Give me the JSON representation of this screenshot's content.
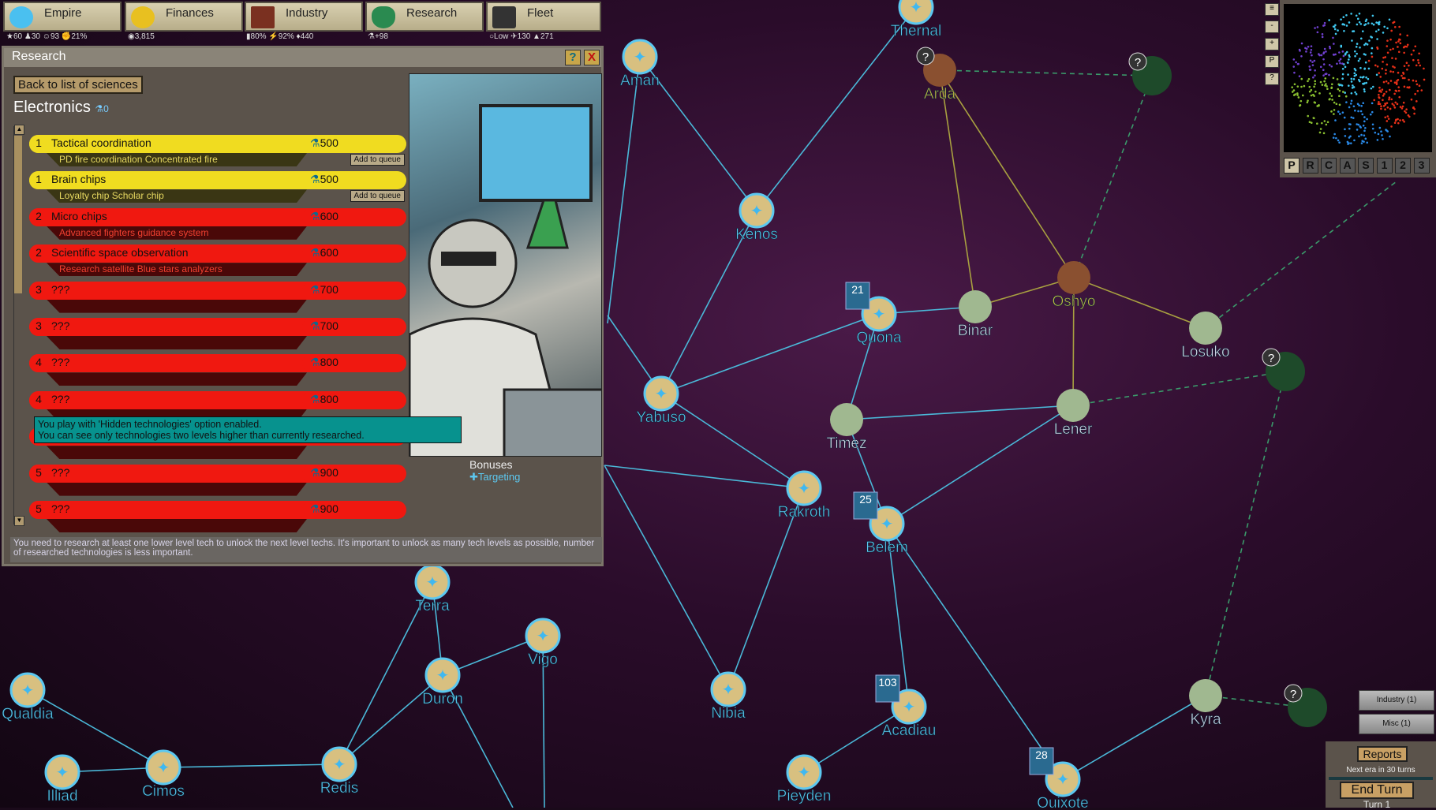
{
  "topbar": {
    "tabs": [
      {
        "label": "Empire",
        "icon": "eagle-icon"
      },
      {
        "label": "Finances",
        "icon": "coin-icon"
      },
      {
        "label": "Industry",
        "icon": "factory-icon"
      },
      {
        "label": "Research",
        "icon": "flask-icon"
      },
      {
        "label": "Fleet",
        "icon": "ship-icon"
      }
    ],
    "stats": {
      "empire": [
        "60",
        "30",
        "93",
        "21%"
      ],
      "finances": [
        "3,815"
      ],
      "industry": [
        "80%",
        "92%",
        "440"
      ],
      "research": [
        "+98"
      ],
      "fleet": [
        "Low",
        "130",
        "271"
      ]
    }
  },
  "panel": {
    "title": "Research",
    "help": "?",
    "close": "X",
    "back_label": "Back to list of sciences",
    "category": "Electronics",
    "category_points": "0",
    "queue_label": "Add to queue",
    "techs": [
      {
        "level": "1",
        "name": "Tactical coordination",
        "cost": "500",
        "unlocks": "PD fire coordination   Concentrated fire",
        "status": "available"
      },
      {
        "level": "1",
        "name": "Brain chips",
        "cost": "500",
        "unlocks": "Loyalty chip   Scholar chip",
        "status": "available"
      },
      {
        "level": "2",
        "name": "Micro chips",
        "cost": "600",
        "unlocks": "Advanced fighters guidance system",
        "status": "locked"
      },
      {
        "level": "2",
        "name": "Scientific space observation",
        "cost": "600",
        "unlocks": "Research satellite   Blue stars analyzers",
        "status": "locked"
      },
      {
        "level": "3",
        "name": "???",
        "cost": "700",
        "unlocks": "",
        "status": "locked"
      },
      {
        "level": "3",
        "name": "???",
        "cost": "700",
        "unlocks": "",
        "status": "locked"
      },
      {
        "level": "4",
        "name": "???",
        "cost": "800",
        "unlocks": "",
        "status": "locked"
      },
      {
        "level": "4",
        "name": "???",
        "cost": "800",
        "unlocks": "",
        "status": "locked"
      },
      {
        "level": "5",
        "name": "???",
        "cost": "900",
        "unlocks": "",
        "status": "locked"
      },
      {
        "level": "5",
        "name": "???",
        "cost": "900",
        "unlocks": "",
        "status": "locked"
      },
      {
        "level": "5",
        "name": "???",
        "cost": "900",
        "unlocks": "",
        "status": "locked"
      }
    ],
    "tooltip": [
      "You play with 'Hidden technologies' option enabled.",
      "You can see only technologies two levels higher than currently researched."
    ],
    "bonuses_title": "Bonuses",
    "bonuses": [
      "Targeting"
    ],
    "footer": "You need to research at least one lower level tech to unlock the next level techs. It's important to unlock as many tech levels as possible, number of researched technologies is less important."
  },
  "minimap": {
    "modes": [
      "P",
      "R",
      "C",
      "A",
      "S",
      "1",
      "2",
      "3"
    ],
    "active_mode": "P",
    "side_buttons": [
      "≡",
      "-",
      "+",
      "P",
      "?"
    ]
  },
  "notifications": [
    "Industry (1)",
    "Misc (1)"
  ],
  "turn": {
    "reports": "Reports",
    "next_era": "Next era in 30 turns",
    "end_turn": "End Turn",
    "turn": "Turn 1"
  },
  "map": {
    "stars": [
      {
        "name": "Thernal",
        "owner": "player"
      },
      {
        "name": "Aman",
        "owner": "player"
      },
      {
        "name": "Arda",
        "owner": "enemy"
      },
      {
        "name": "",
        "owner": "unknown"
      },
      {
        "name": "Kenos",
        "owner": "player"
      },
      {
        "name": "Oshyo",
        "owner": "enemy"
      },
      {
        "name": "Binar",
        "owner": "neutral"
      },
      {
        "name": "Quona",
        "owner": "player",
        "fleet": "21"
      },
      {
        "name": "Losuko",
        "owner": "neutral"
      },
      {
        "name": "",
        "owner": "unknown"
      },
      {
        "name": "Yabuso",
        "owner": "player"
      },
      {
        "name": "Timez",
        "owner": "neutral"
      },
      {
        "name": "Lener",
        "owner": "neutral"
      },
      {
        "name": "Rakroth",
        "owner": "player"
      },
      {
        "name": "Belem",
        "owner": "player",
        "fleet": "25"
      },
      {
        "name": "Terra",
        "owner": "player"
      },
      {
        "name": "Vigo",
        "owner": "player"
      },
      {
        "name": "Duron",
        "owner": "player"
      },
      {
        "name": "Nibia",
        "owner": "player"
      },
      {
        "name": "Qualdia",
        "owner": "player"
      },
      {
        "name": "Acadiau",
        "owner": "player",
        "fleet": "103"
      },
      {
        "name": "Kyra",
        "owner": "neutral"
      },
      {
        "name": "",
        "owner": "unknown"
      },
      {
        "name": "Illiad",
        "owner": "player"
      },
      {
        "name": "Cimos",
        "owner": "player"
      },
      {
        "name": "Redis",
        "owner": "player"
      },
      {
        "name": "Pieyden",
        "owner": "player"
      },
      {
        "name": "Quixote",
        "owner": "player",
        "fleet": "28"
      }
    ],
    "lanes": [
      [
        "Thernal",
        "Kenos"
      ],
      [
        "Aman",
        "Kenos"
      ],
      [
        "Kenos",
        "Yabuso"
      ],
      [
        "Yabuso",
        "Quona"
      ],
      [
        "Yabuso",
        "Rakroth"
      ],
      [
        "Quona",
        "Binar"
      ],
      [
        "Quona",
        "Timez"
      ],
      [
        "Timez",
        "Belem"
      ],
      [
        "Timez",
        "Lener"
      ],
      [
        "Binar",
        "Oshyo"
      ],
      [
        "Arda",
        "Binar"
      ],
      [
        "Arda",
        "Oshyo"
      ],
      [
        "Oshyo",
        "Losuko"
      ],
      [
        "Oshyo",
        "Lener"
      ],
      [
        "Lener",
        "Belem"
      ],
      [
        "Belem",
        "Acadiau"
      ],
      [
        "Belem",
        "Quixote"
      ],
      [
        "Rakroth",
        "Nibia"
      ],
      [
        "Terra",
        "Duron"
      ],
      [
        "Duron",
        "Vigo"
      ],
      [
        "Terra",
        "Redis"
      ],
      [
        "Qualdia",
        "Cimos"
      ],
      [
        "Cimos",
        "Illiad"
      ],
      [
        "Cimos",
        "Redis"
      ],
      [
        "Acadiau",
        "Pieyden"
      ],
      [
        "Kyra",
        "Quixote"
      ],
      [
        "Duron",
        "Redis"
      ]
    ]
  },
  "colors": {
    "player": "#5cc8f0",
    "enemy": "#c8b840",
    "lane": "#4ab8d8",
    "available": "#f0dc20",
    "locked": "#f01810"
  }
}
